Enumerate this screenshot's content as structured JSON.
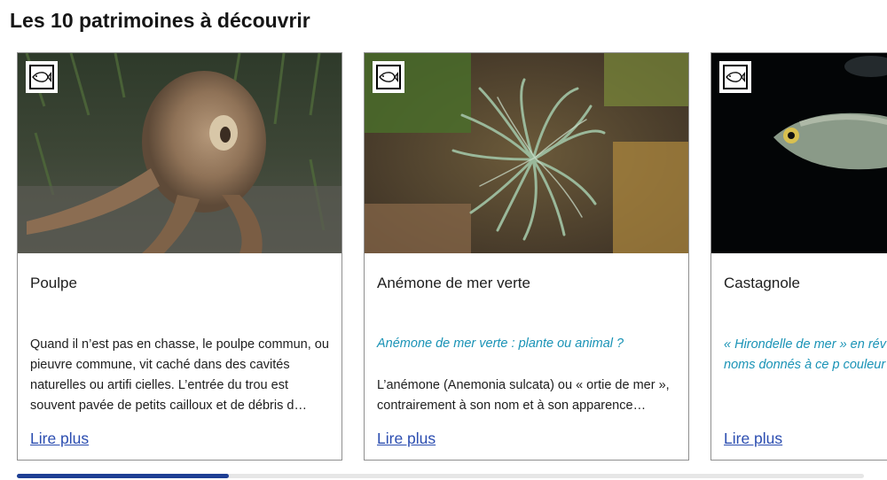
{
  "section": {
    "title": "Les 10 patrimoines à découvrir"
  },
  "cards": [
    {
      "title": "Poulpe",
      "subtitle": "",
      "description": "Quand il n’est pas en chasse, le poulpe commun, ou pieuvre commune, vit caché dans des cavités naturelles ou artifi cielles. L’entrée du trou est souvent pavée de petits cailloux et de débris d…",
      "link": "Lire plus",
      "icon": "fish-icon"
    },
    {
      "title": "Anémone de mer verte",
      "subtitle": "Anémone de mer verte : plante ou animal ?",
      "description": "L’anémone (Anemonia sulcata) ou « ortie de mer », contrairement à son nom et à son apparence…",
      "link": "Lire plus",
      "icon": "fish-icon"
    },
    {
      "title": "Castagnole",
      "subtitle": "",
      "description": "« Hirondelle de mer » en rév caudale en ciseaux ou « de autres noms donnés à ce p couleur brun sombre qui, de",
      "link": "Lire plus",
      "icon": "fish-icon"
    }
  ],
  "carousel": {
    "progress": 0.25
  },
  "colors": {
    "accent_italic": "#1a93b6",
    "link": "#2b4db0",
    "progress": "#1e3f94"
  }
}
